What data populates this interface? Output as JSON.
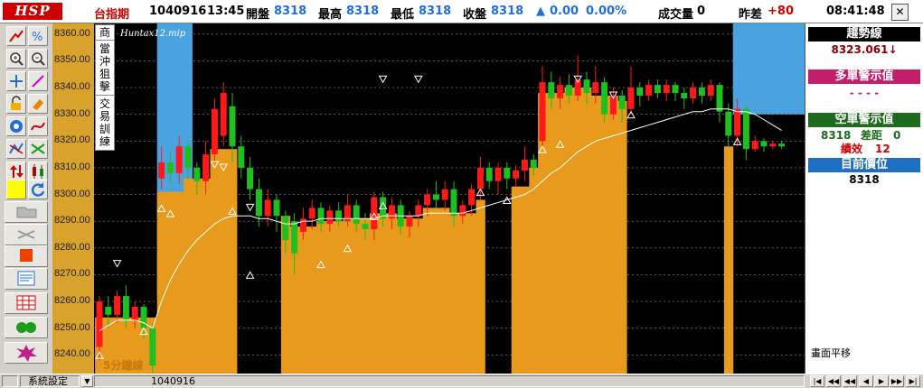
{
  "header": {
    "logo": "HSP",
    "symbol": "台指期",
    "date": "1040916",
    "time": "13:45",
    "open_label": "開盤",
    "open_value": "8318",
    "high_label": "最高",
    "high_value": "8318",
    "low_label": "最低",
    "low_value": "8318",
    "close_label": "收盤",
    "close_value": "8318",
    "change_arrow": "▲",
    "change": "0.00",
    "change_pct": "0.00%",
    "volume_label": "成交量",
    "volume_value": "0",
    "prev_label": "昨差",
    "prev_value": "+80",
    "clock": "08:41:48",
    "close_icon": "close-icon"
  },
  "chart": {
    "file_label": "Huntax12.mip",
    "period_label": "5分鐘線",
    "side_tabs": [
      "商",
      "當沖狙擊",
      "交易訓練"
    ],
    "up_color": "#ff1a1a",
    "down_color": "#1fbf1f",
    "fill_color": "#e89a1c",
    "band_color": "#4aa3df",
    "ma_color": "#ffffff"
  },
  "chart_data": {
    "type": "candlestick",
    "title": "",
    "period": "5分鐘線",
    "ylim": [
      8233,
      8364
    ],
    "y_ticks": [
      8360.0,
      8350.0,
      8340.0,
      8330.0,
      8320.0,
      8310.0,
      8300.0,
      8290.0,
      8280.0,
      8270.0,
      8260.0,
      8250.0,
      8240.0
    ],
    "candles": [
      {
        "o": 8243,
        "c": 8260,
        "h": 8262,
        "l": 8238
      },
      {
        "o": 8258,
        "c": 8255,
        "h": 8262,
        "l": 8250
      },
      {
        "o": 8255,
        "c": 8262,
        "h": 8264,
        "l": 8252
      },
      {
        "o": 8262,
        "c": 8253,
        "h": 8266,
        "l": 8250
      },
      {
        "o": 8253,
        "c": 8258,
        "h": 8260,
        "l": 8250
      },
      {
        "o": 8258,
        "c": 8250,
        "h": 8259,
        "l": 8246
      },
      {
        "o": 8250,
        "c": 8236,
        "h": 8252,
        "l": 8232
      },
      {
        "o": 8306,
        "c": 8312,
        "h": 8318,
        "l": 8302
      },
      {
        "o": 8312,
        "c": 8308,
        "h": 8316,
        "l": 8304
      },
      {
        "o": 8308,
        "c": 8318,
        "h": 8322,
        "l": 8304
      },
      {
        "o": 8318,
        "c": 8310,
        "h": 8320,
        "l": 8306
      },
      {
        "o": 8310,
        "c": 8305,
        "h": 8312,
        "l": 8300
      },
      {
        "o": 8305,
        "c": 8315,
        "h": 8320,
        "l": 8300
      },
      {
        "o": 8315,
        "c": 8332,
        "h": 8336,
        "l": 8312
      },
      {
        "o": 8322,
        "c": 8338,
        "h": 8342,
        "l": 8318
      },
      {
        "o": 8333,
        "c": 8318,
        "h": 8338,
        "l": 8312
      },
      {
        "o": 8318,
        "c": 8310,
        "h": 8322,
        "l": 8306
      },
      {
        "o": 8310,
        "c": 8302,
        "h": 8314,
        "l": 8298
      },
      {
        "o": 8302,
        "c": 8292,
        "h": 8306,
        "l": 8288
      },
      {
        "o": 8292,
        "c": 8298,
        "h": 8302,
        "l": 8288
      },
      {
        "o": 8298,
        "c": 8292,
        "h": 8300,
        "l": 8286
      },
      {
        "o": 8292,
        "c": 8283,
        "h": 8294,
        "l": 8278
      },
      {
        "o": 8290,
        "c": 8278,
        "h": 8293,
        "l": 8270
      },
      {
        "o": 8286,
        "c": 8291,
        "h": 8295,
        "l": 8283
      },
      {
        "o": 8291,
        "c": 8295,
        "h": 8298,
        "l": 8287
      },
      {
        "o": 8295,
        "c": 8289,
        "h": 8297,
        "l": 8286
      },
      {
        "o": 8289,
        "c": 8294,
        "h": 8296,
        "l": 8286
      },
      {
        "o": 8294,
        "c": 8290,
        "h": 8297,
        "l": 8288
      },
      {
        "o": 8290,
        "c": 8296,
        "h": 8300,
        "l": 8288
      },
      {
        "o": 8296,
        "c": 8289,
        "h": 8298,
        "l": 8286
      },
      {
        "o": 8289,
        "c": 8287,
        "h": 8293,
        "l": 8283
      },
      {
        "o": 8287,
        "c": 8299,
        "h": 8301,
        "l": 8283
      },
      {
        "o": 8299,
        "c": 8291,
        "h": 8301,
        "l": 8288
      },
      {
        "o": 8291,
        "c": 8296,
        "h": 8299,
        "l": 8287
      },
      {
        "o": 8296,
        "c": 8288,
        "h": 8298,
        "l": 8285
      },
      {
        "o": 8288,
        "c": 8292,
        "h": 8294,
        "l": 8284
      },
      {
        "o": 8292,
        "c": 8296,
        "h": 8298,
        "l": 8288
      },
      {
        "o": 8296,
        "c": 8300,
        "h": 8302,
        "l": 8292
      },
      {
        "o": 8300,
        "c": 8298,
        "h": 8305,
        "l": 8295
      },
      {
        "o": 8298,
        "c": 8302,
        "h": 8305,
        "l": 8294
      },
      {
        "o": 8302,
        "c": 8292,
        "h": 8305,
        "l": 8288
      },
      {
        "o": 8292,
        "c": 8296,
        "h": 8298,
        "l": 8289
      },
      {
        "o": 8296,
        "c": 8302,
        "h": 8304,
        "l": 8292
      },
      {
        "o": 8302,
        "c": 8310,
        "h": 8314,
        "l": 8298
      },
      {
        "o": 8310,
        "c": 8305,
        "h": 8312,
        "l": 8302
      },
      {
        "o": 8305,
        "c": 8310,
        "h": 8312,
        "l": 8300
      },
      {
        "o": 8310,
        "c": 8306,
        "h": 8312,
        "l": 8302
      },
      {
        "o": 8306,
        "c": 8309,
        "h": 8311,
        "l": 8303
      },
      {
        "o": 8309,
        "c": 8313,
        "h": 8318,
        "l": 8305
      },
      {
        "o": 8313,
        "c": 8310,
        "h": 8315,
        "l": 8307
      },
      {
        "o": 8320,
        "c": 8342,
        "h": 8348,
        "l": 8318
      },
      {
        "o": 8342,
        "c": 8336,
        "h": 8346,
        "l": 8332
      },
      {
        "o": 8336,
        "c": 8341,
        "h": 8344,
        "l": 8332
      },
      {
        "o": 8341,
        "c": 8337,
        "h": 8345,
        "l": 8334
      },
      {
        "o": 8337,
        "c": 8343,
        "h": 8352,
        "l": 8335
      },
      {
        "o": 8343,
        "c": 8338,
        "h": 8346,
        "l": 8334
      },
      {
        "o": 8338,
        "c": 8342,
        "h": 8348,
        "l": 8334
      },
      {
        "o": 8342,
        "c": 8330,
        "h": 8344,
        "l": 8327
      },
      {
        "o": 8330,
        "c": 8337,
        "h": 8340,
        "l": 8328
      },
      {
        "o": 8337,
        "c": 8332,
        "h": 8339,
        "l": 8327
      },
      {
        "o": 8332,
        "c": 8340,
        "h": 8348,
        "l": 8330
      },
      {
        "o": 8340,
        "c": 8337,
        "h": 8342,
        "l": 8333
      },
      {
        "o": 8337,
        "c": 8341,
        "h": 8343,
        "l": 8335
      },
      {
        "o": 8341,
        "c": 8338,
        "h": 8343,
        "l": 8336
      },
      {
        "o": 8338,
        "c": 8341,
        "h": 8343,
        "l": 8335
      },
      {
        "o": 8341,
        "c": 8338,
        "h": 8342,
        "l": 8335
      },
      {
        "o": 8338,
        "c": 8336,
        "h": 8340,
        "l": 8332
      },
      {
        "o": 8336,
        "c": 8340,
        "h": 8342,
        "l": 8334
      },
      {
        "o": 8340,
        "c": 8337,
        "h": 8342,
        "l": 8334
      },
      {
        "o": 8337,
        "c": 8341,
        "h": 8343,
        "l": 8335
      },
      {
        "o": 8341,
        "c": 8331,
        "h": 8342,
        "l": 8327
      },
      {
        "o": 8331,
        "c": 8322,
        "h": 8334,
        "l": 8318
      },
      {
        "o": 8322,
        "c": 8332,
        "h": 8336,
        "l": 8318
      },
      {
        "o": 8332,
        "c": 8317,
        "h": 8333,
        "l": 8313
      },
      {
        "o": 8317,
        "c": 8320,
        "h": 8322,
        "l": 8316
      },
      {
        "o": 8320,
        "c": 8318,
        "h": 8321,
        "l": 8316
      },
      {
        "o": 8318,
        "c": 8319,
        "h": 8320,
        "l": 8317
      },
      {
        "o": 8319,
        "c": 8318,
        "h": 8320,
        "l": 8317
      }
    ],
    "ma": [
      8249,
      8251,
      8253,
      8253,
      8253,
      8252,
      8250,
      8260,
      8268,
      8274,
      8279,
      8283,
      8286,
      8289,
      8291,
      8292,
      8292,
      8292,
      8291,
      8291,
      8290,
      8289,
      8289,
      8290,
      8290,
      8291,
      8291,
      8291,
      8291,
      8291,
      8291,
      8291,
      8292,
      8292,
      8292,
      8292,
      8292,
      8293,
      8293,
      8293,
      8293,
      8293,
      8294,
      8295,
      8296,
      8297,
      8298,
      8299,
      8300,
      8302,
      8305,
      8308,
      8310,
      8313,
      8316,
      8318,
      8320,
      8321,
      8322,
      8323,
      8324,
      8325,
      8326,
      8327,
      8328,
      8329,
      8330,
      8331,
      8331,
      8332,
      8332,
      8332,
      8331,
      8331,
      8330,
      8328,
      8326,
      8324
    ],
    "fill_upper": [
      8254,
      8254,
      8254,
      8254,
      8254,
      8254,
      8254,
      8301,
      8301,
      8301,
      8306,
      8306,
      8306,
      8317,
      8317,
      8317,
      8300,
      8300,
      8300,
      8292,
      8292,
      8292,
      8288,
      8288,
      8288,
      8290,
      8290,
      8290,
      8291,
      8291,
      8291,
      8293,
      8293,
      8293,
      8291,
      8291,
      8291,
      8295,
      8295,
      8295,
      8293,
      8293,
      8293,
      8298,
      8298,
      8298,
      8303,
      8303,
      8303,
      8310,
      8338,
      8338,
      8338,
      8340,
      8340,
      8340,
      8337,
      8337,
      8337,
      8335,
      8335,
      8335,
      8336,
      8336,
      8336,
      8337,
      8337,
      8337,
      8320,
      8320,
      8320,
      8318,
      8318,
      8318,
      8318,
      8318,
      8318,
      8318
    ],
    "fill_mask": [
      1,
      1,
      1,
      1,
      1,
      1,
      1,
      1,
      1,
      1,
      1,
      1,
      1,
      1,
      1,
      1,
      0,
      0,
      0,
      0,
      0,
      1,
      1,
      1,
      1,
      1,
      1,
      1,
      1,
      1,
      1,
      1,
      1,
      1,
      1,
      1,
      1,
      1,
      1,
      1,
      1,
      1,
      1,
      1,
      0,
      0,
      0,
      1,
      1,
      1,
      1,
      1,
      1,
      1,
      1,
      1,
      1,
      1,
      1,
      1,
      0,
      0,
      0,
      0,
      0,
      0,
      0,
      0,
      0,
      0,
      0,
      1,
      0,
      0,
      0,
      0,
      0,
      0
    ],
    "bands": [
      [
        7,
        10,
        8364,
        8262
      ],
      [
        72,
        90,
        8364,
        8330
      ],
      [
        84,
        97,
        8364,
        8335
      ]
    ],
    "up_marks": [
      [
        0,
        8240
      ],
      [
        5,
        8249
      ],
      [
        7,
        8295
      ],
      [
        8,
        8293
      ],
      [
        15,
        8294
      ],
      [
        17,
        8270
      ],
      [
        25,
        8274
      ],
      [
        28,
        8280
      ],
      [
        31,
        8292
      ],
      [
        32,
        8296
      ],
      [
        43,
        8301
      ],
      [
        46,
        8298
      ],
      [
        50,
        8317
      ],
      [
        52,
        8319
      ],
      [
        60,
        8330
      ],
      [
        72,
        8320
      ]
    ],
    "down_marks": [
      [
        2,
        8274
      ],
      [
        13,
        8311
      ],
      [
        14,
        8310
      ],
      [
        17,
        8295
      ],
      [
        32,
        8343
      ],
      [
        36,
        8343
      ],
      [
        54,
        8343
      ],
      [
        58,
        8337
      ]
    ]
  },
  "right_panel": {
    "trend_label": "趨勢線",
    "trend_value": "8323.061↓",
    "long_label": "多單警示值",
    "long_value": "- - - -",
    "short_label": "空單警示值",
    "short_price": "8318",
    "short_diff_label": "差距",
    "short_diff": "0",
    "perf_label": "績效",
    "perf_value": "12",
    "pos_label": "目前價位",
    "pos_value": "8318",
    "pan_label": "畫面平移"
  },
  "statusbar": {
    "settings": "系統設定",
    "date": "1040916"
  }
}
